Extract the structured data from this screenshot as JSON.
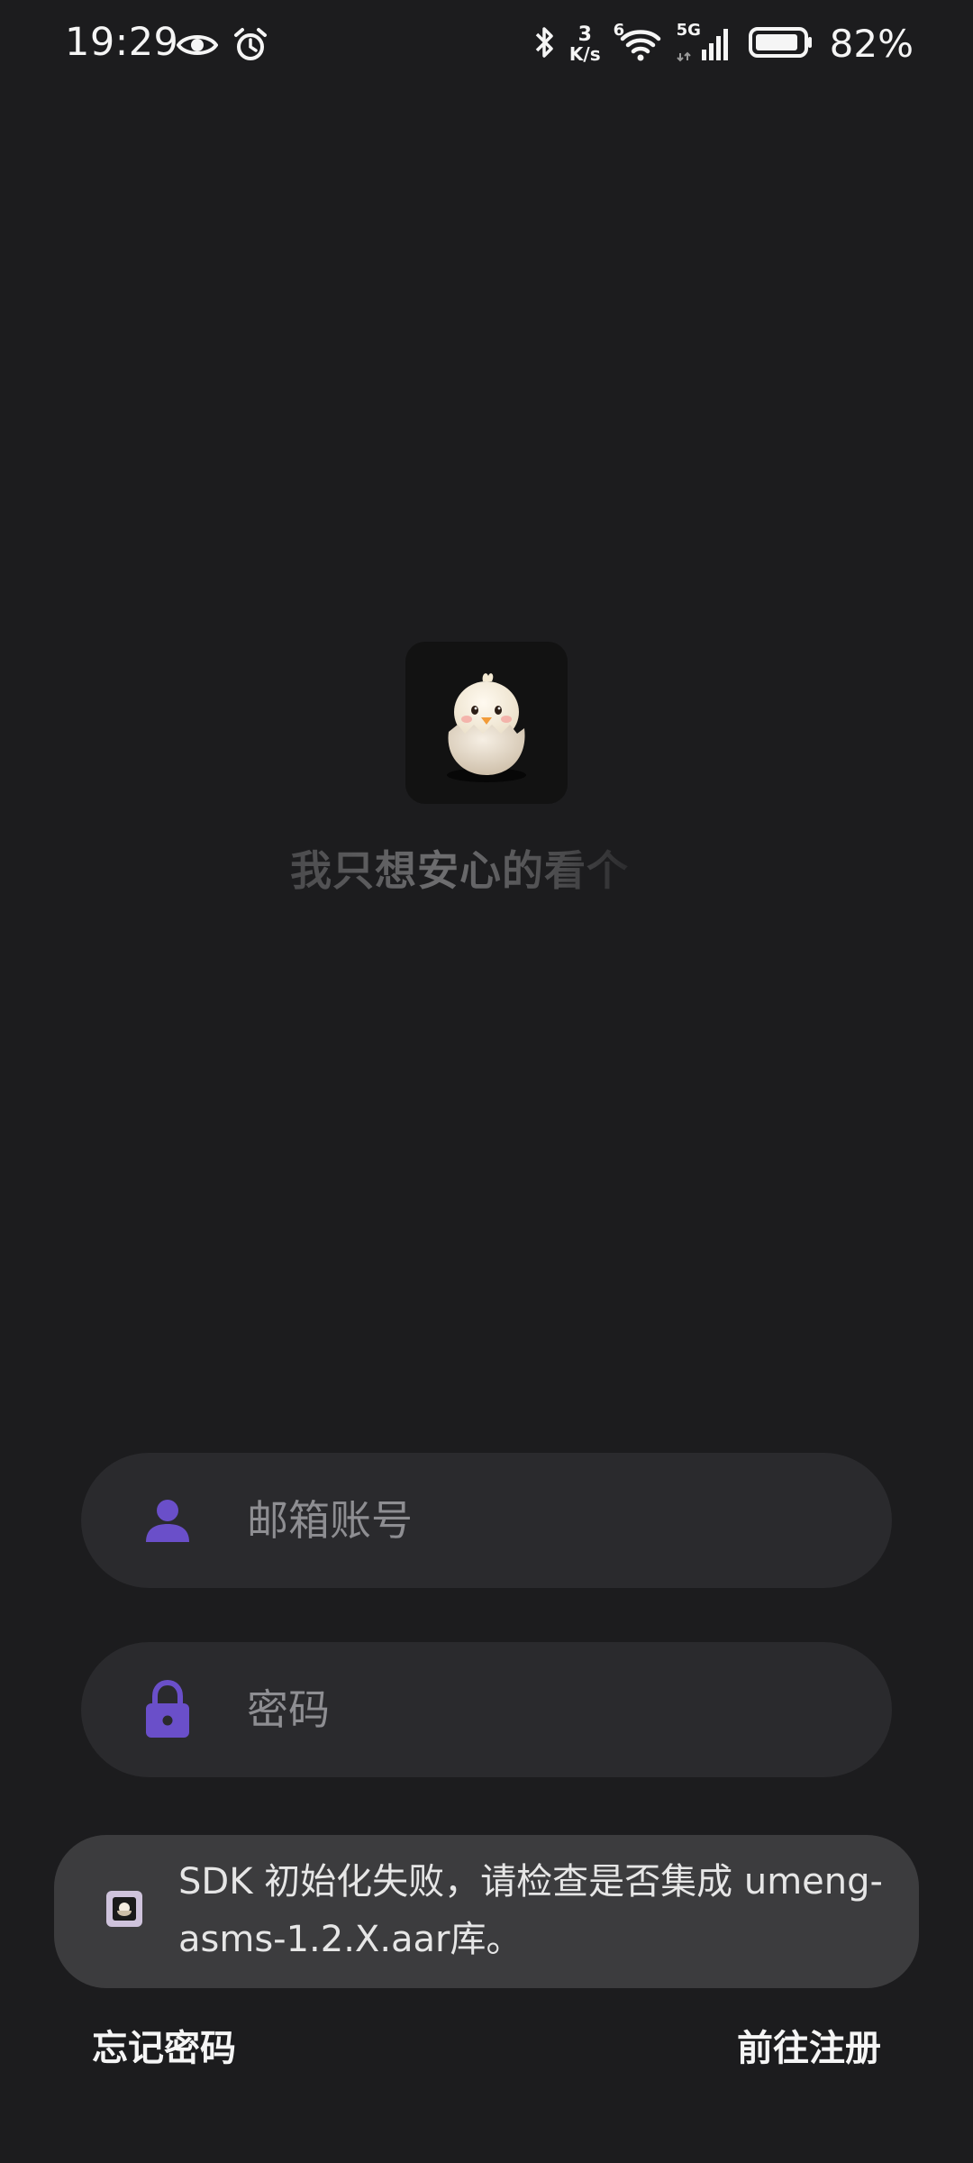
{
  "status_bar": {
    "time": "19:29",
    "net_speed_value": "3",
    "net_speed_unit": "K/s",
    "wifi_badge": "6",
    "cell_badge": "5G",
    "battery_percent": "82%"
  },
  "app": {
    "slogan": "我只想安心的看个"
  },
  "login": {
    "email_placeholder": "邮箱账号",
    "password_placeholder": "密码"
  },
  "toast": {
    "message": "SDK 初始化失败，请检查是否集成 umeng-asms-1.2.X.aar库。"
  },
  "links": {
    "forgot_password": "忘记密码",
    "register": "前往注册"
  },
  "colors": {
    "background": "#1c1c1e",
    "input_bg": "#2a2a2d",
    "accent_icon": "#6a4fc9",
    "toast_bg": "#3c3c3e"
  }
}
